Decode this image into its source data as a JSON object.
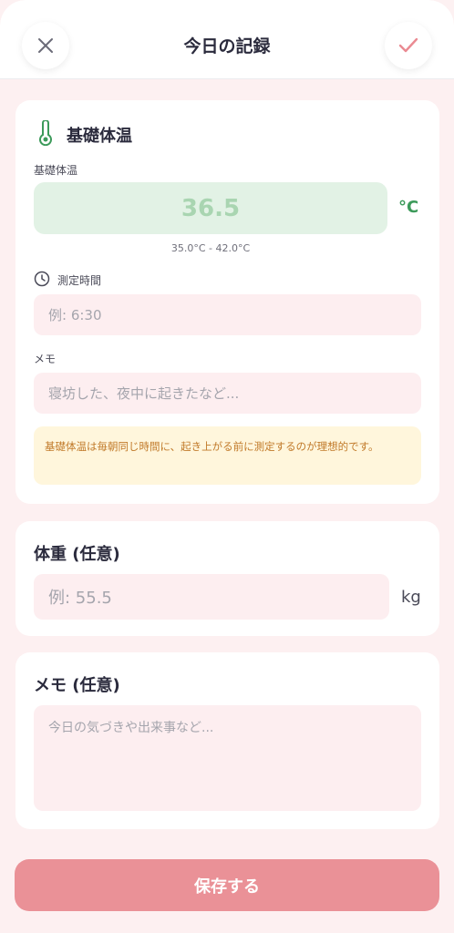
{
  "header": {
    "title": "今日の記録"
  },
  "bbt": {
    "section_title": "基礎体温",
    "field_label": "基礎体温",
    "temp_placeholder": "36.5",
    "unit": "°C",
    "range": "35.0°C - 42.0°C",
    "time_label": "測定時間",
    "time_placeholder": "例: 6:30",
    "memo_label": "メモ",
    "memo_placeholder": "寝坊した、夜中に起きたなど...",
    "note": "基礎体温は毎朝同じ時間に、起き上がる前に測定するのが理想的です。"
  },
  "weight": {
    "title": "体重 (任意)",
    "placeholder": "例: 55.5",
    "unit": "kg"
  },
  "memo": {
    "title": "メモ (任意)",
    "placeholder": "今日の気づきや出来事など..."
  },
  "save_label": "保存する",
  "colors": {
    "accent_pink": "#ea9197",
    "thermo_green": "#3c9a5a",
    "note_bg": "#fff6dc",
    "note_text": "#c17a2a"
  },
  "icons": [
    "close-icon",
    "check-icon",
    "thermometer-icon",
    "clock-icon"
  ]
}
